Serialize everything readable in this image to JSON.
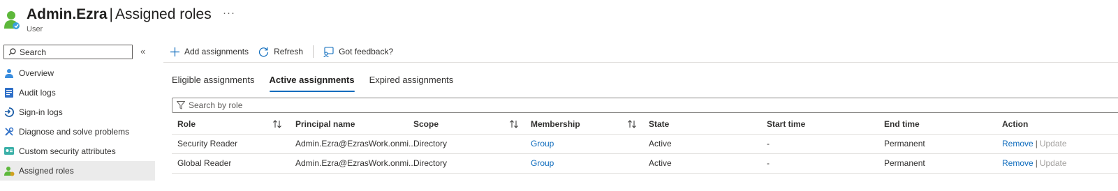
{
  "header": {
    "title_user": "Admin.Ezra",
    "title_sep": "|",
    "title_page": "Assigned roles",
    "more": "···",
    "subtitle": "User"
  },
  "sidebar": {
    "search_placeholder": "Search",
    "collapse": "«",
    "items": [
      {
        "label": "Overview",
        "icon": "person-icon"
      },
      {
        "label": "Audit logs",
        "icon": "audit-log-icon"
      },
      {
        "label": "Sign-in logs",
        "icon": "sign-in-icon"
      },
      {
        "label": "Diagnose and solve problems",
        "icon": "wrench-icon"
      },
      {
        "label": "Custom security attributes",
        "icon": "security-attributes-icon"
      },
      {
        "label": "Assigned roles",
        "icon": "assigned-roles-icon",
        "active": true
      }
    ]
  },
  "toolbar": {
    "add": "Add assignments",
    "refresh": "Refresh",
    "feedback": "Got feedback?"
  },
  "tabs": [
    {
      "label": "Eligible assignments"
    },
    {
      "label": "Active assignments",
      "active": true
    },
    {
      "label": "Expired assignments"
    }
  ],
  "filter": {
    "placeholder": "Search by role"
  },
  "table": {
    "columns": [
      "Role",
      "Principal name",
      "Scope",
      "Membership",
      "State",
      "Start time",
      "End time",
      "Action"
    ],
    "rows": [
      {
        "role": "Security Reader",
        "principal": "Admin.Ezra@EzrasWork.onmi...",
        "scope": "Directory",
        "membership": "Group",
        "state": "Active",
        "start": "-",
        "end": "Permanent",
        "remove": "Remove",
        "sep": "|",
        "update": "Update"
      },
      {
        "role": "Global Reader",
        "principal": "Admin.Ezra@EzrasWork.onmi...",
        "scope": "Directory",
        "membership": "Group",
        "state": "Active",
        "start": "-",
        "end": "Permanent",
        "remove": "Remove",
        "sep": "|",
        "update": "Update"
      }
    ]
  },
  "colors": {
    "accent": "#0f6cbd",
    "link": "#0f6cbd",
    "active_nav_bg": "#ebebeb"
  }
}
